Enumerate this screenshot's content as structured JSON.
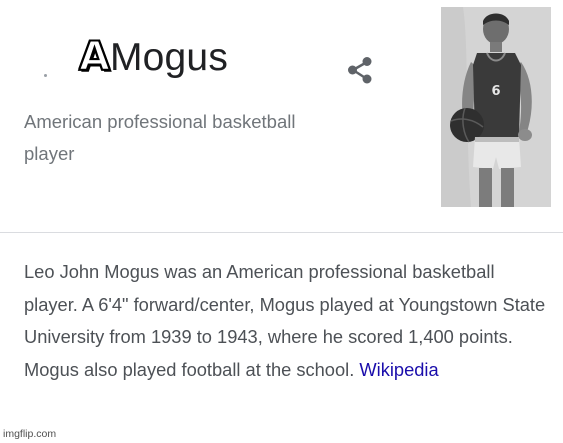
{
  "knowledge_panel": {
    "title_overlay": "A",
    "title": "Mogus",
    "subtitle": "American professional basketball player",
    "description": "Leo John Mogus was an American professional basketball player. A 6'4\" forward/center, Mogus played at Youngstown State University from 1939 to 1943, where he scored 1,400 points. Mogus also played football at the school.",
    "source_link": "Wikipedia",
    "jersey_number": "6"
  },
  "watermark": "imgflip.com",
  "colors": {
    "title": "#202124",
    "subtitle": "#70757a",
    "body_text": "#4d5156",
    "link": "#1a0dab",
    "divider": "#dadce0"
  },
  "icons": {
    "share": "share-icon"
  }
}
